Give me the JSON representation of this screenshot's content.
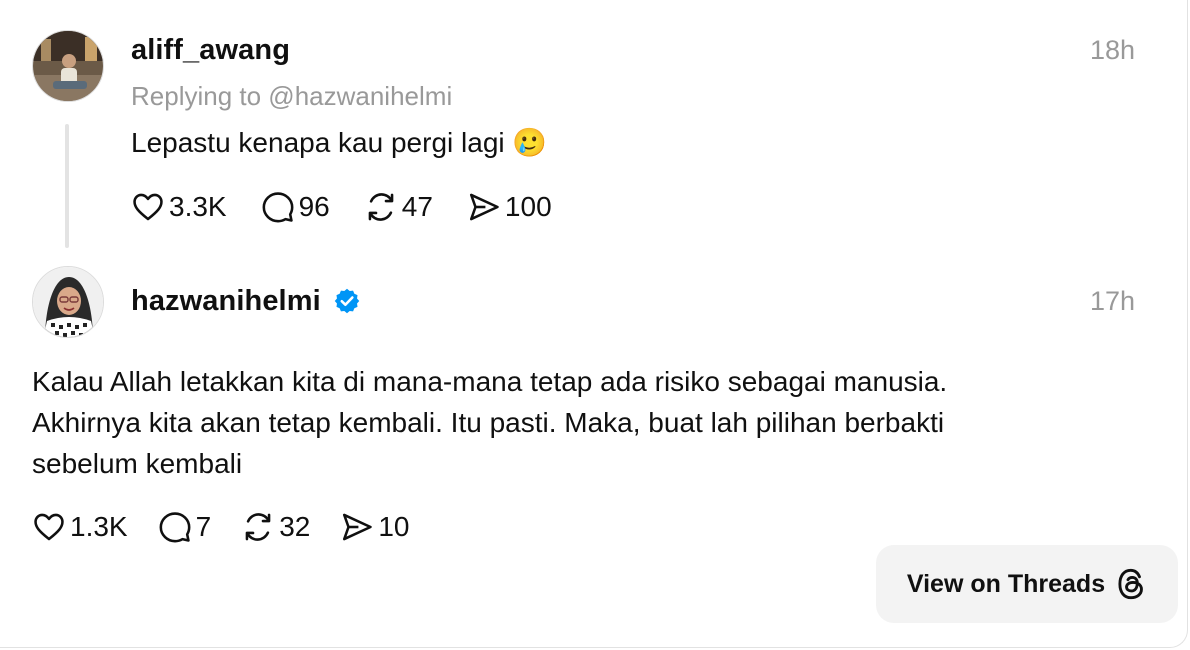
{
  "post1": {
    "username": "aliff_awang",
    "time": "18h",
    "replying_to": "Replying to @hazwanihelmi",
    "text": "Lepastu kenapa kau pergi lagi 🥲",
    "likes": "3.3K",
    "replies": "96",
    "reposts": "47",
    "shares": "100"
  },
  "post2": {
    "username": "hazwanihelmi",
    "verified": true,
    "time": "17h",
    "text_lines": [
      "Kalau Allah letakkan kita di mana-mana tetap ada risiko sebagai manusia.",
      "Akhirnya kita akan tetap kembali. Itu pasti. Maka, buat lah pilihan berbakti",
      "sebelum kembali"
    ],
    "likes": "1.3K",
    "replies": "7",
    "reposts": "32",
    "shares": "10"
  },
  "view_button": {
    "label": "View on Threads"
  },
  "colors": {
    "verified_blue": "#0095f6",
    "muted_text": "#999999",
    "button_bg": "#f3f3f3"
  }
}
